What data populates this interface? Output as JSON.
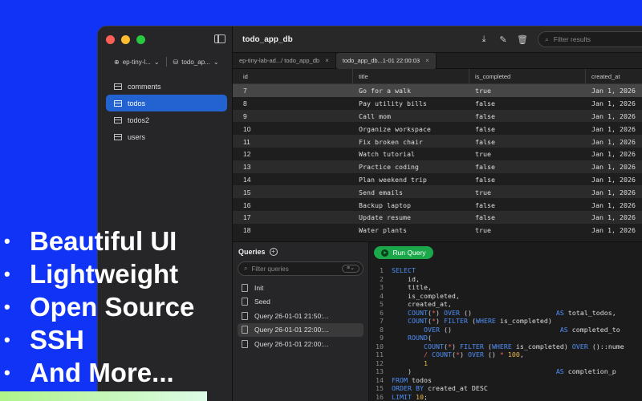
{
  "window": {
    "title": "todo_app_db",
    "filter_placeholder": "Filter results"
  },
  "sidebar": {
    "connection": "ep-tiny-l...",
    "database": "todo_ap...",
    "tables": [
      {
        "label": "comments"
      },
      {
        "label": "todos",
        "active": true
      },
      {
        "label": "todos2"
      },
      {
        "label": "users"
      }
    ]
  },
  "tabs": [
    {
      "label": "ep-tiny-lab-ad.../ todo_app_db"
    },
    {
      "label": "todo_app_db...1-01 22:00:03",
      "active": true
    }
  ],
  "grid": {
    "columns": [
      "id",
      "title",
      "is_completed",
      "created_at"
    ],
    "rows": [
      [
        "7",
        "Go for a walk",
        "true",
        "Jan 1, 2026"
      ],
      [
        "8",
        "Pay utility bills",
        "false",
        "Jan 1, 2026"
      ],
      [
        "9",
        "Call mom",
        "false",
        "Jan 1, 2026"
      ],
      [
        "10",
        "Organize workspace",
        "false",
        "Jan 1, 2026"
      ],
      [
        "11",
        "Fix broken chair",
        "false",
        "Jan 1, 2026"
      ],
      [
        "12",
        "Watch tutorial",
        "true",
        "Jan 1, 2026"
      ],
      [
        "13",
        "Practice coding",
        "false",
        "Jan 1, 2026"
      ],
      [
        "14",
        "Plan weekend trip",
        "false",
        "Jan 1, 2026"
      ],
      [
        "15",
        "Send emails",
        "true",
        "Jan 1, 2026"
      ],
      [
        "16",
        "Backup laptop",
        "false",
        "Jan 1, 2026"
      ],
      [
        "17",
        "Update resume",
        "false",
        "Jan 1, 2026"
      ],
      [
        "18",
        "Water plants",
        "true",
        "Jan 1, 2026"
      ]
    ],
    "selected_row": 0
  },
  "queries": {
    "title": "Queries",
    "filter_placeholder": "Filter queries",
    "items": [
      {
        "label": "Init"
      },
      {
        "label": "Seed"
      },
      {
        "label": "Query 26-01-01 21:50:..."
      },
      {
        "label": "Query 26-01-01 22:00:...",
        "active": true
      },
      {
        "label": "Query 26-01-01 22:00:..."
      }
    ]
  },
  "editor": {
    "run_label": "Run Query",
    "lines": [
      [
        [
          "kw",
          "SELECT"
        ]
      ],
      [
        [
          "t",
          "    id,"
        ]
      ],
      [
        [
          "t",
          "    title,"
        ]
      ],
      [
        [
          "t",
          "    is_completed,"
        ]
      ],
      [
        [
          "t",
          "    created_at,"
        ]
      ],
      [
        [
          "t",
          "    "
        ],
        [
          "kw",
          "COUNT"
        ],
        [
          "t",
          "("
        ],
        [
          "op",
          "*"
        ],
        [
          "t",
          ") "
        ],
        [
          "kw",
          "OVER"
        ],
        [
          "t",
          " ()                     "
        ],
        [
          "kw",
          "AS"
        ],
        [
          "t",
          " total_todos,"
        ]
      ],
      [
        [
          "t",
          "    "
        ],
        [
          "kw",
          "COUNT"
        ],
        [
          "t",
          "("
        ],
        [
          "op",
          "*"
        ],
        [
          "t",
          ") "
        ],
        [
          "kw",
          "FILTER"
        ],
        [
          "t",
          " ("
        ],
        [
          "kw",
          "WHERE"
        ],
        [
          "t",
          " is_completed)"
        ]
      ],
      [
        [
          "t",
          "        "
        ],
        [
          "kw",
          "OVER"
        ],
        [
          "t",
          " ()                           "
        ],
        [
          "kw",
          "AS"
        ],
        [
          "t",
          " completed_to"
        ]
      ],
      [
        [
          "t",
          "    "
        ],
        [
          "kw",
          "ROUND"
        ],
        [
          "t",
          "("
        ]
      ],
      [
        [
          "t",
          "        "
        ],
        [
          "kw",
          "COUNT"
        ],
        [
          "t",
          "("
        ],
        [
          "op",
          "*"
        ],
        [
          "t",
          ") "
        ],
        [
          "kw",
          "FILTER"
        ],
        [
          "t",
          " ("
        ],
        [
          "kw",
          "WHERE"
        ],
        [
          "t",
          " is_completed) "
        ],
        [
          "kw",
          "OVER"
        ],
        [
          "t",
          " ()::nume"
        ]
      ],
      [
        [
          "t",
          "        "
        ],
        [
          "op",
          "/"
        ],
        [
          "t",
          " "
        ],
        [
          "kw",
          "COUNT"
        ],
        [
          "t",
          "("
        ],
        [
          "op",
          "*"
        ],
        [
          "t",
          ") "
        ],
        [
          "kw",
          "OVER"
        ],
        [
          "t",
          " () "
        ],
        [
          "op",
          "*"
        ],
        [
          "t",
          " "
        ],
        [
          "num",
          "100"
        ],
        [
          "t",
          ","
        ]
      ],
      [
        [
          "t",
          "        "
        ],
        [
          "num",
          "1"
        ]
      ],
      [
        [
          "t",
          "    )                                    "
        ],
        [
          "kw",
          "AS"
        ],
        [
          "t",
          " completion_p"
        ]
      ],
      [
        [
          "kw",
          "FROM"
        ],
        [
          "t",
          " todos"
        ]
      ],
      [
        [
          "kw",
          "ORDER BY"
        ],
        [
          "t",
          " created_at DESC"
        ]
      ],
      [
        [
          "kw",
          "LIMIT"
        ],
        [
          "t",
          " "
        ],
        [
          "num",
          "10"
        ],
        [
          "t",
          ";"
        ]
      ]
    ]
  },
  "overlay": {
    "bullet_char": "•",
    "bullets": [
      "Beautiful UI",
      "Lightweight",
      "Open Source",
      "SSH",
      "And More..."
    ]
  },
  "colors": {
    "background": "#1133f5",
    "accent": "#2363d1",
    "run": "#1aa84a"
  }
}
